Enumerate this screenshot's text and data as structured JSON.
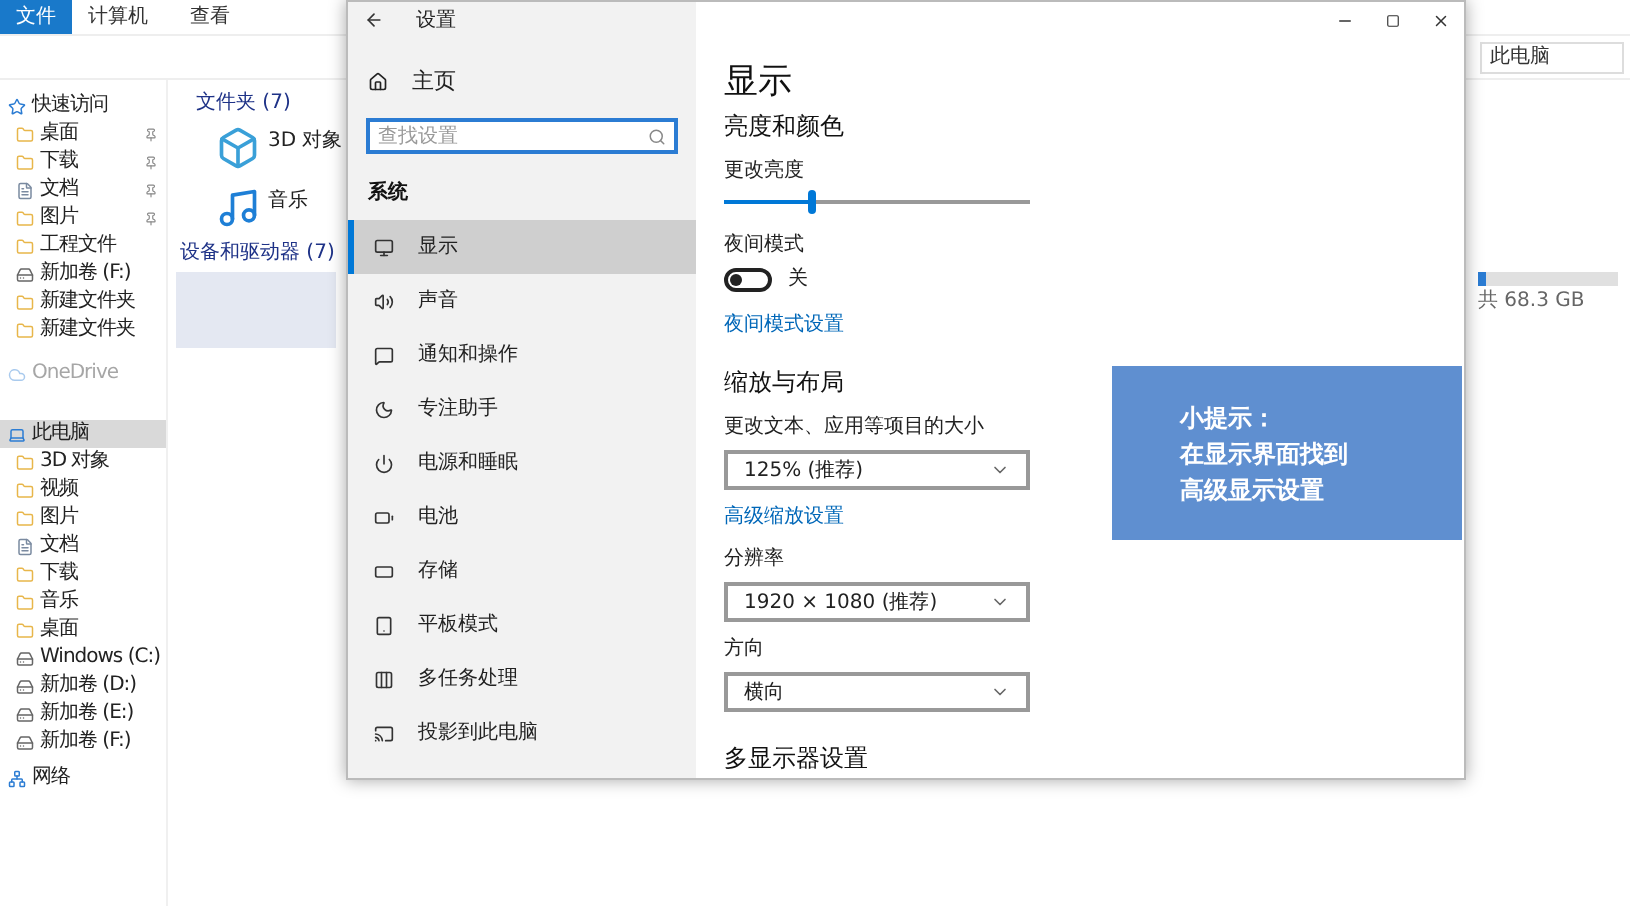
{
  "explorer": {
    "ribbon_tabs": [
      {
        "label": "文件",
        "selected": true
      },
      {
        "label": "计算机",
        "selected": false
      },
      {
        "label": "查看",
        "selected": false
      }
    ],
    "address": "此电脑",
    "nav": [
      {
        "label": "快速访问",
        "kind": "star",
        "pinned": false,
        "selected": false
      },
      {
        "label": "桌面",
        "kind": "folder",
        "pinned": true,
        "selected": false
      },
      {
        "label": "下载",
        "kind": "folder",
        "pinned": true,
        "selected": false
      },
      {
        "label": "文档",
        "kind": "doc",
        "pinned": true,
        "selected": false
      },
      {
        "label": "图片",
        "kind": "folder",
        "pinned": true,
        "selected": false
      },
      {
        "label": "工程文件",
        "kind": "folder",
        "pinned": false,
        "selected": false
      },
      {
        "label": "新加卷 (F:)",
        "kind": "drive",
        "pinned": false,
        "selected": false
      },
      {
        "label": "新建文件夹",
        "kind": "folder",
        "pinned": false,
        "selected": false
      },
      {
        "label": "新建文件夹",
        "kind": "folder",
        "pinned": false,
        "selected": false
      },
      {
        "label": "OneDrive",
        "kind": "cloud",
        "pinned": false,
        "selected": false
      },
      {
        "label": "此电脑",
        "kind": "pc",
        "pinned": false,
        "selected": true
      },
      {
        "label": "3D 对象",
        "kind": "folder",
        "pinned": false,
        "selected": false
      },
      {
        "label": "视频",
        "kind": "folder",
        "pinned": false,
        "selected": false
      },
      {
        "label": "图片",
        "kind": "folder",
        "pinned": false,
        "selected": false
      },
      {
        "label": "文档",
        "kind": "doc",
        "pinned": false,
        "selected": false
      },
      {
        "label": "下载",
        "kind": "folder",
        "pinned": false,
        "selected": false
      },
      {
        "label": "音乐",
        "kind": "folder",
        "pinned": false,
        "selected": false
      },
      {
        "label": "桌面",
        "kind": "folder",
        "pinned": false,
        "selected": false
      },
      {
        "label": "Windows (C:)",
        "kind": "drive",
        "pinned": false,
        "selected": false
      },
      {
        "label": "新加卷 (D:)",
        "kind": "drive",
        "pinned": false,
        "selected": false
      },
      {
        "label": "新加卷 (E:)",
        "kind": "drive",
        "pinned": false,
        "selected": false
      },
      {
        "label": "新加卷 (F:)",
        "kind": "drive",
        "pinned": false,
        "selected": false
      },
      {
        "label": "网络",
        "kind": "network",
        "pinned": false,
        "selected": false
      }
    ],
    "folders_header": "文件夹 (7)",
    "folders": [
      {
        "label": "3D 对象"
      },
      {
        "label": "音乐"
      }
    ],
    "devices_header": "设备和驱动器 (7)",
    "drive": {
      "level": 0.05,
      "size": "共 68.3 GB"
    }
  },
  "settings": {
    "title": "设置",
    "home": "主页",
    "search": {
      "placeholder": "查找设置"
    },
    "section": "系统",
    "items": [
      {
        "label": "显示",
        "selected": true
      },
      {
        "label": "声音",
        "selected": false
      },
      {
        "label": "通知和操作",
        "selected": false
      },
      {
        "label": "专注助手",
        "selected": false
      },
      {
        "label": "电源和睡眠",
        "selected": false
      },
      {
        "label": "电池",
        "selected": false
      },
      {
        "label": "存储",
        "selected": false
      },
      {
        "label": "平板模式",
        "selected": false
      },
      {
        "label": "多任务处理",
        "selected": false
      },
      {
        "label": "投影到此电脑",
        "selected": false
      }
    ],
    "page_title": "显示",
    "brightness_heading": "亮度和颜色",
    "brightness": {
      "label": "更改亮度",
      "level": 0.29
    },
    "night": {
      "label": "夜间模式",
      "on": false,
      "state": "关"
    },
    "night_link": "夜间模式设置",
    "scale_heading": "缩放与布局",
    "dropdowns": [
      {
        "label": "更改文本、应用等项目的大小",
        "value": "125% (推荐)"
      }
    ],
    "scale_link": "高级缩放设置",
    "dropdowns2": [
      {
        "label": "分辨率",
        "value": "1920 × 1080 (推荐)"
      },
      {
        "label": "方向",
        "value": "横向"
      }
    ],
    "multi_heading": "多显示器设置"
  },
  "tip": [
    "小提示：",
    "在显示界面找到",
    "高级显示设置"
  ]
}
